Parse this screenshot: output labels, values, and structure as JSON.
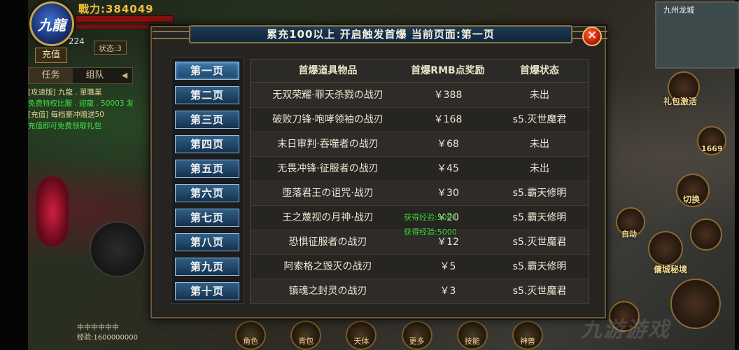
{
  "hud": {
    "avatar_text": "九龍",
    "power_label": "戰力:384049",
    "level": "224",
    "status_chip": "状态:3",
    "recharge": "充值",
    "tabs": [
      "任务",
      "组队"
    ],
    "quest_log": [
      {
        "text": "[攻速版] 九龍 . 單職業",
        "green": false
      },
      {
        "text": "免费特权比服 . 迎龍 . 50003 发现",
        "green": true
      },
      {
        "text": "[充值] 每档豪冲赠送50",
        "green": false
      },
      {
        "text": "充值即可免费领取礼包",
        "green": true
      }
    ],
    "bottom_hint_1": "中中中中中中",
    "bottom_hint_2": "经验:1600000000"
  },
  "right_hud": {
    "minimap_title": "九州龙城",
    "gift_label": "礼包激活",
    "count_label": "1669",
    "switch_label": "切换",
    "auto_label": "自动",
    "city_label": "傭城秘境"
  },
  "bottom_menu": [
    "角色",
    "背包",
    "天体",
    "更多",
    "技能",
    "神兽"
  ],
  "watermark": "九游游戏",
  "dialog": {
    "title": "累充100以上 开启触发首爆 当前页面:第一页",
    "close_icon": "close-x-icon",
    "pages": [
      "第一页",
      "第二页",
      "第三页",
      "第四页",
      "第五页",
      "第六页",
      "第七页",
      "第八页",
      "第九页",
      "第十页"
    ],
    "active_page": 0,
    "headers": [
      "首爆道具物品",
      "首爆RMB点奖励",
      "首爆状态"
    ],
    "rows": [
      {
        "item": "无双荣耀·罪天杀戮の战刃",
        "reward": "￥388",
        "status": "未出"
      },
      {
        "item": "破败刀锋·咆哮领袖の战刃",
        "reward": "￥168",
        "status": "s5.灭世魔君"
      },
      {
        "item": "末日审判·吞噬者の战刃",
        "reward": "￥68",
        "status": "未出"
      },
      {
        "item": "无畏冲锋·征服者の战刃",
        "reward": "￥45",
        "status": "未出"
      },
      {
        "item": "堕落君王の诅咒·战刃",
        "reward": "￥30",
        "status": "s5.霸天修明"
      },
      {
        "item": "王之蔑视の月神·战刃",
        "reward": "￥20",
        "status": "s5.霸天修明"
      },
      {
        "item": "恐惧征服者の战刃",
        "reward": "￥12",
        "status": "s5.灭世魔君"
      },
      {
        "item": "阿索格之毁灭の战刃",
        "reward": "￥5",
        "status": "s5.霸天修明"
      },
      {
        "item": "镇魂之封灵の战刃",
        "reward": "￥3",
        "status": "s5.灭世魔君"
      }
    ],
    "floating_exp": [
      "获得经验:5000",
      "获得经验:5000"
    ]
  },
  "colors": {
    "accent_gold": "#c9a24a",
    "tab_blue": "#2f5f87",
    "exp_green": "#4ae04a",
    "close_red": "#c4240c"
  }
}
